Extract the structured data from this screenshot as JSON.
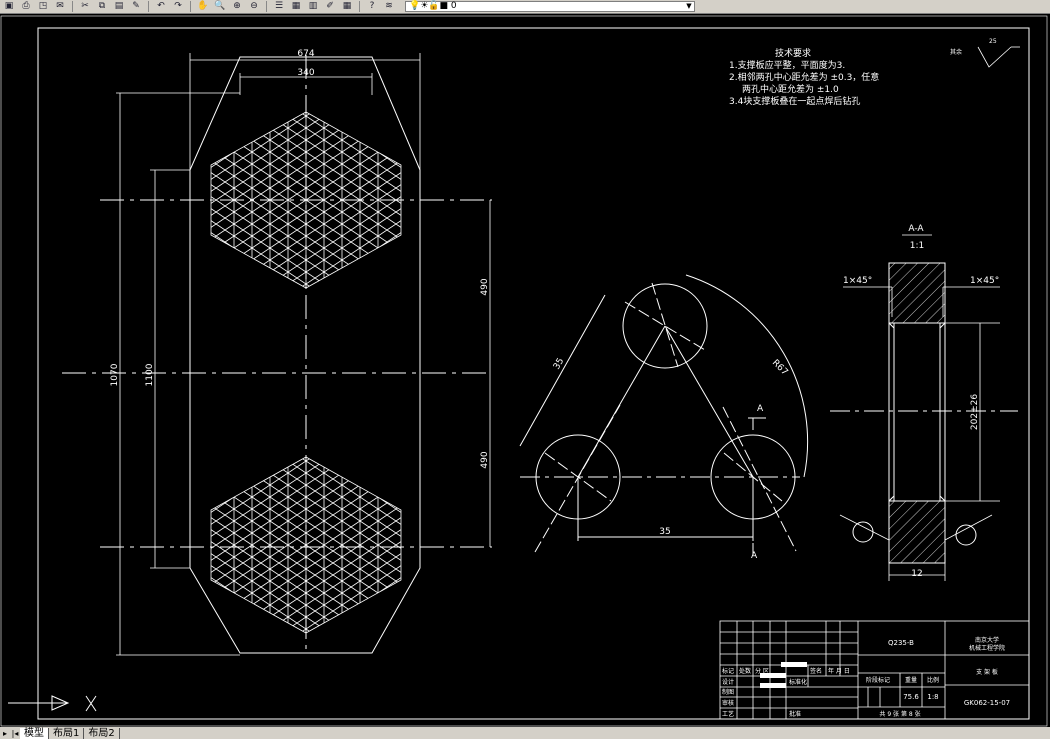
{
  "toolbar": {
    "buttons": [
      "save-icon",
      "print-icon",
      "preview-icon",
      "publish-icon",
      "cut-icon",
      "copy-icon",
      "paste-icon",
      "matchprop-icon",
      "undo-icon",
      "redo-icon",
      "pan-icon",
      "zoom-realtime-icon",
      "zoom-window-icon",
      "zoom-previous-icon",
      "properties-icon",
      "designcenter-icon",
      "toolpalettes-icon",
      "markup-icon",
      "calculator-icon",
      "help-icon",
      "layer-manager-icon"
    ],
    "layer_value": "0"
  },
  "tabs": {
    "model": "模型",
    "layout1": "布局1",
    "layout2": "布局2"
  },
  "drawing": {
    "notes": {
      "title": "技术要求",
      "line1": "1.支撑板应平整，平面度为3.",
      "line2": "2.相邻两孔中心距允差为 ±0.3，任意",
      "line3": "两孔中心距允差为 ±1.0",
      "line4": "3.4块支撑板叠在一起点焊后钻孔"
    },
    "roughness": {
      "prefix": "其余",
      "value": "25"
    },
    "dims": {
      "width_outer": "674",
      "width_inner": "340",
      "height_outer": "1070",
      "height_inner": "1100",
      "spacing_top": "490",
      "spacing_bottom": "490",
      "tri_side": "35",
      "tri_base": "35",
      "arc": "R67"
    },
    "section": {
      "title": "A-A",
      "scale": "1:1",
      "chamfer_left": "1×45°",
      "chamfer_right": "1×45°",
      "diameter": "202±26",
      "thickness": "12",
      "marker": "A"
    },
    "title_block": {
      "material": "Q235-B",
      "school_line1": "南京大学",
      "school_line2": "机械工程学院",
      "part_name": "支 架 板",
      "drawing_no": "GK062-15-07",
      "weight": "75.6",
      "scale": "1:8",
      "stage_label": "阶段标记",
      "weight_label": "重量",
      "scale_label": "比例",
      "sheet_text": "共  9  张  第  8  张",
      "row_labels": [
        "标记",
        "设计",
        "制图",
        "审核",
        "工艺"
      ],
      "col_labels": [
        "处数",
        "分 区",
        "更改文件号",
        "签名",
        "年 月 日"
      ],
      "std_label": "标准化",
      "approve_label": "批准"
    }
  }
}
